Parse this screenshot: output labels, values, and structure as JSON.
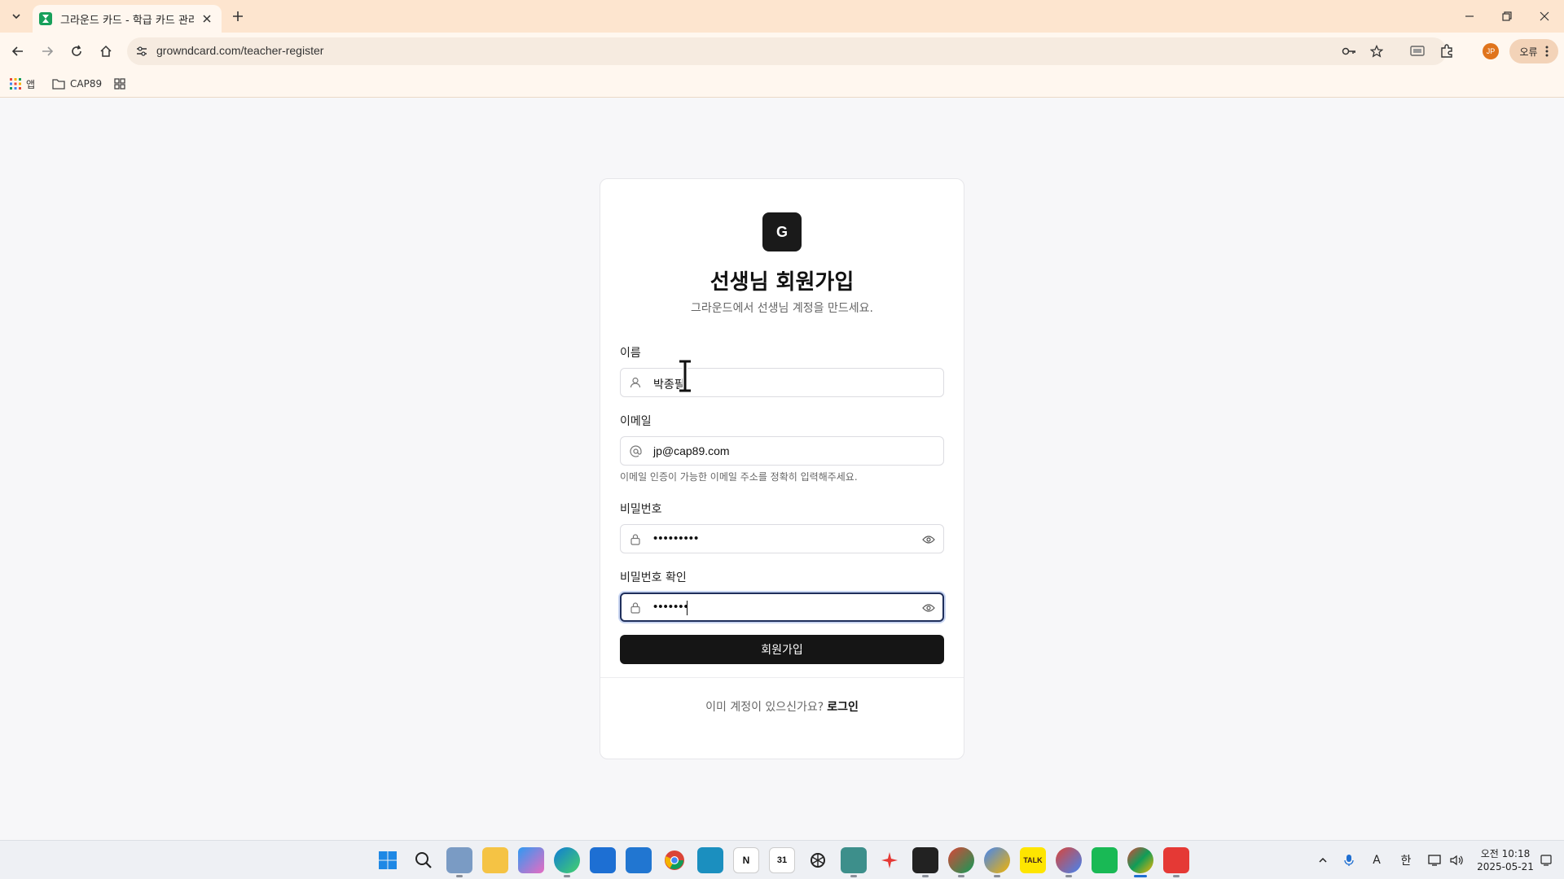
{
  "browser": {
    "tab_title": "그라운드 카드 - 학급 카드 관리",
    "url": "growndcard.com/teacher-register",
    "profile_initials": "JP",
    "error_label": "오류",
    "bookmarks": [
      {
        "label": "앱",
        "icon": "apps-grid-icon"
      },
      {
        "label": "CAP89",
        "icon": "folder-icon"
      },
      {
        "label": "",
        "icon": "tab-groups-icon"
      }
    ]
  },
  "page": {
    "logo_letter": "G",
    "title": "선생님 회원가입",
    "subtitle": "그라운드에서 선생님 계정을 만드세요.",
    "name": {
      "label": "이름",
      "value": "박종필"
    },
    "email": {
      "label": "이메일",
      "value": "jp@cap89.com",
      "hint": "이메일 인증이 가능한 이메일 주소를 정확히 입력해주세요."
    },
    "password": {
      "label": "비밀번호",
      "value": "•••••••••"
    },
    "password_confirm": {
      "label": "비밀번호 확인",
      "value": "•••••••"
    },
    "submit_label": "회원가입",
    "footer_text": "이미 계정이 있으신가요?",
    "login_link": "로그인"
  },
  "colors": {
    "tabstrip": "#fde5cf",
    "card_bg": "#ffffff",
    "button_bg": "#151515",
    "focus_ring": "#1f2f5c"
  },
  "taskbar": {
    "apps": [
      "windows-start",
      "search",
      "file-explorer-user",
      "file-explorer",
      "copilot",
      "edge",
      "microsoft-store",
      "samsung-pass",
      "chrome",
      "app-blue",
      "notion",
      "calendar-31",
      "chatgpt",
      "snipping",
      "spark",
      "terminal-app",
      "chrome-profile-1",
      "chrome-profile-2",
      "kakaotalk",
      "chrome-profile-3",
      "naver-app",
      "chrome-active",
      "app-red"
    ],
    "kakaotalk_label": "TALK",
    "calendar_label": "31",
    "notion_label": "N",
    "ime_label": "한",
    "font_label": "A",
    "time": "오전 10:18",
    "date": "2025-05-21"
  }
}
